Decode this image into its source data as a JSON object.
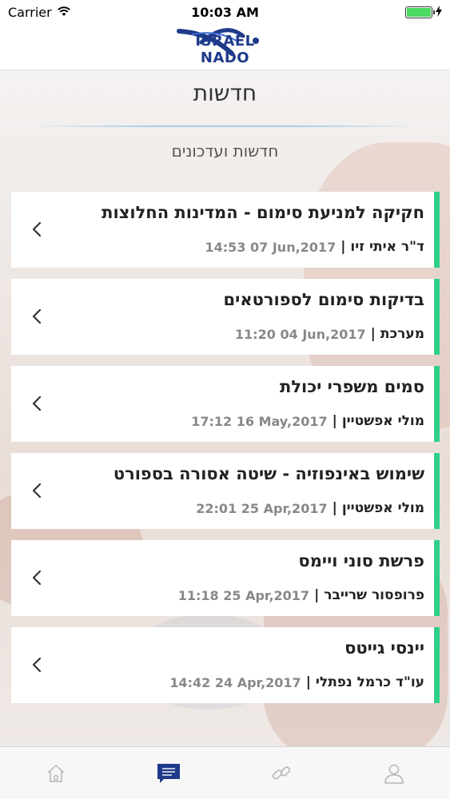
{
  "status_bar": {
    "carrier": "Carrier",
    "time": "10:03 AM",
    "battery_level": 1.0
  },
  "header": {
    "logo_text": "ISRAEL NADO"
  },
  "page": {
    "title": "חדשות",
    "subtitle": "חדשות ועדכונים"
  },
  "news": [
    {
      "headline": "חקיקה למניעת סימום - המדינות החלוצות",
      "author": "ד\"ר איתי זיו",
      "date": "14:53 07 Jun,2017"
    },
    {
      "headline": "בדיקות סימום לספורטאים",
      "author": "מערכת",
      "date": "11:20 04 Jun,2017"
    },
    {
      "headline": "סמים משפרי יכולת",
      "author": "מולי אפשטיין",
      "date": "17:12 16 May,2017"
    },
    {
      "headline": "שימוש באינפוזיה - שיטה אסורה בספורט",
      "author": "מולי אפשטיין",
      "date": "22:01 25 Apr,2017"
    },
    {
      "headline": "פרשת סוני ויימס",
      "author": "פרופסור שרייבר",
      "date": "11:18 25 Apr,2017"
    },
    {
      "headline": "יינסי גייטס",
      "author": "עו\"ד כרמל נפתלי",
      "date": "14:42 24 Apr,2017"
    }
  ],
  "tab_bar": {
    "tabs": [
      {
        "icon": "home-icon",
        "active": false
      },
      {
        "icon": "chat-icon",
        "active": true
      },
      {
        "icon": "link-icon",
        "active": false
      },
      {
        "icon": "user-icon",
        "active": false
      }
    ]
  },
  "colors": {
    "accent": "#2ed08a",
    "active_tab": "#1e3a8a",
    "inactive_tab": "#b5b5b5"
  }
}
